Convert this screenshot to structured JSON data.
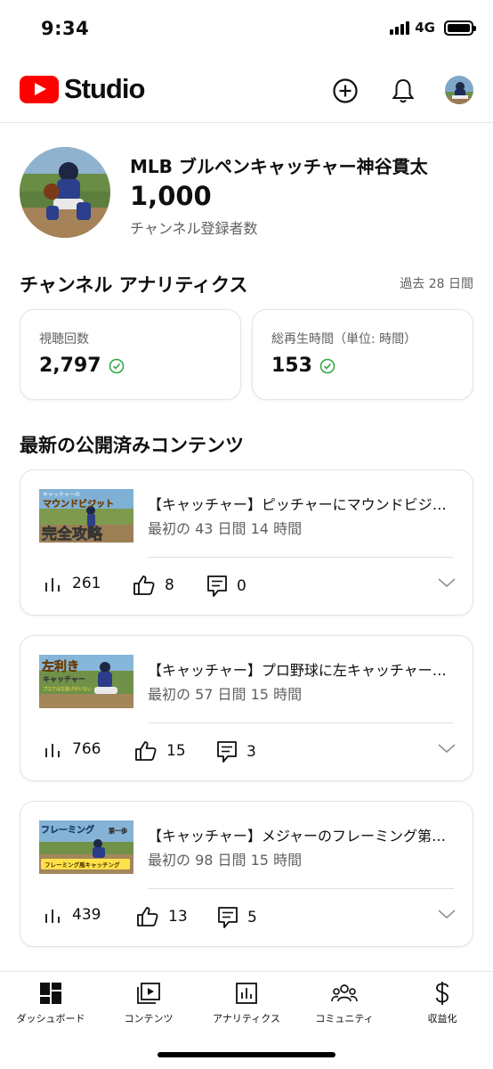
{
  "status_bar": {
    "time": "9:34",
    "network": "4G"
  },
  "header": {
    "logo_text": "Studio",
    "create_icon": "add-circle-icon",
    "notifications_icon": "bell-icon"
  },
  "channel": {
    "name": "MLB ブルペンキャッチャー神谷貫太",
    "subscriber_count": "1,000",
    "subscriber_label": "チャンネル登録者数"
  },
  "analytics": {
    "title": "チャンネル アナリティクス",
    "period": "過去 28 日間",
    "metrics": [
      {
        "label": "視聴回数",
        "value": "2,797"
      },
      {
        "label": "総再生時間（単位: 時間）",
        "value": "153"
      }
    ]
  },
  "latest": {
    "title": "最新の公開済みコンテンツ",
    "items": [
      {
        "title": "【キャッチャー】ピッチャーにマウンドビジットで完全攻略",
        "subtitle": "最初の 43 日間 14 時間",
        "views": "261",
        "likes": "8",
        "comments": "0",
        "thumb_lines": [
          "キャッチャーの",
          "マウンドビジット",
          "完全攻略"
        ]
      },
      {
        "title": "【キャッチャー】プロ野球に左キャッチャーがいない理由",
        "subtitle": "最初の 57 日間 15 時間",
        "views": "766",
        "likes": "15",
        "comments": "3",
        "thumb_lines": [
          "左利き",
          "キャッチャー",
          "プロでは左投げがいない"
        ]
      },
      {
        "title": "【キャッチャー】メジャーのフレーミング第一歩",
        "subtitle": "最初の 98 日間 15 時間",
        "views": "439",
        "likes": "13",
        "comments": "5",
        "thumb_lines": [
          "フレーミング",
          "第一歩",
          "フレーミング風キャッチング"
        ]
      }
    ]
  },
  "bottom_nav": {
    "items": [
      {
        "label": "ダッシュボード",
        "icon": "dashboard-icon"
      },
      {
        "label": "コンテンツ",
        "icon": "content-icon"
      },
      {
        "label": "アナリティクス",
        "icon": "analytics-icon"
      },
      {
        "label": "コミュニティ",
        "icon": "community-icon"
      },
      {
        "label": "収益化",
        "icon": "dollar-icon"
      }
    ]
  },
  "colors": {
    "brand_red": "#ff0000",
    "check_green": "#2ba640",
    "text_secondary": "#606060"
  }
}
